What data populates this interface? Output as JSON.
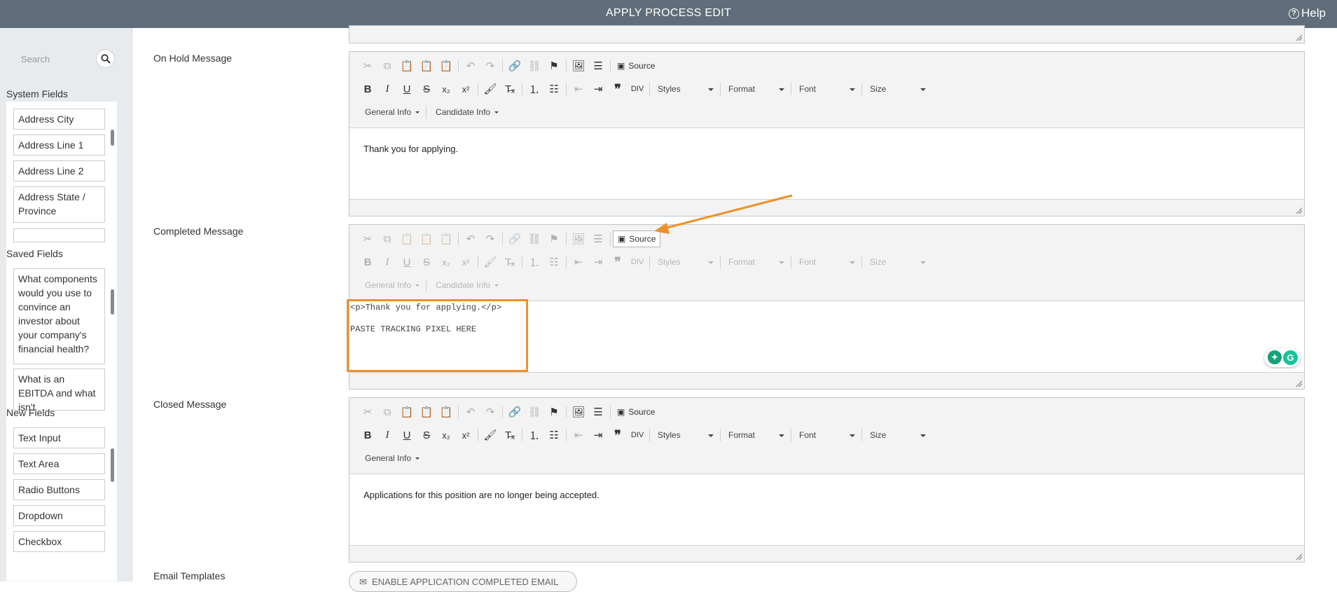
{
  "header": {
    "title": "APPLY PROCESS EDIT",
    "help": "Help"
  },
  "sidebar": {
    "search_placeholder": "Search",
    "system_fields_label": "System Fields",
    "system_fields": [
      "Address City",
      "Address Line 1",
      "Address Line 2",
      "Address State / Province"
    ],
    "saved_fields_label": "Saved Fields",
    "saved_fields": [
      "What components would you use to convince an investor about your company's financial health?",
      "What is an EBITDA and what isn't"
    ],
    "new_fields_label": "New Fields",
    "new_fields": [
      "Text Input",
      "Text Area",
      "Radio Buttons",
      "Dropdown",
      "Checkbox"
    ]
  },
  "toolbar": {
    "source": "Source",
    "styles": "Styles",
    "format": "Format",
    "font": "Font",
    "size": "Size",
    "general_info": "General Info",
    "candidate_info": "Candidate Info"
  },
  "editors": {
    "on_hold": {
      "label": "On Hold Message",
      "content": "Thank you for applying."
    },
    "completed": {
      "label": "Completed Message",
      "source_line1": "<p>Thank you for applying.</p>",
      "source_line2": "PASTE TRACKING PIXEL HERE"
    },
    "closed": {
      "label": "Closed Message",
      "content": "Applications for this position are no longer being accepted."
    }
  },
  "email_templates": {
    "label": "Email Templates",
    "button": "ENABLE APPLICATION COMPLETED EMAIL"
  },
  "annotation": {
    "color": "#f0902a"
  }
}
